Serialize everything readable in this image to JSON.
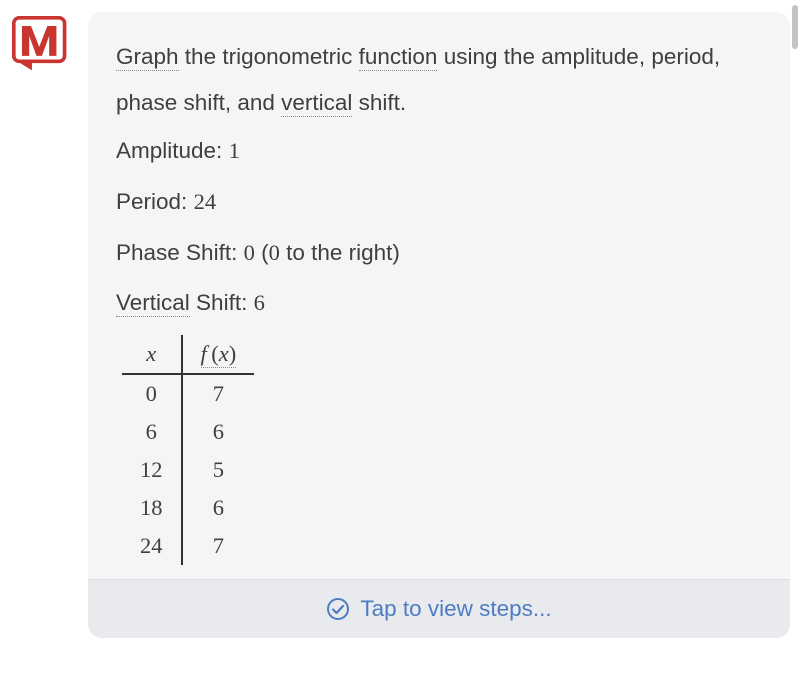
{
  "description": {
    "segments": [
      {
        "text": "Graph",
        "underline": true
      },
      {
        "text": " the trigonometric ",
        "underline": false
      },
      {
        "text": "function",
        "underline": true
      },
      {
        "text": " using the amplitude, period, phase shift, and ",
        "underline": false
      },
      {
        "text": "vertical",
        "underline": true
      },
      {
        "text": " shift.",
        "underline": false
      }
    ]
  },
  "properties": {
    "amplitude": {
      "label": "Amplitude:",
      "value": "1"
    },
    "period": {
      "label": "Period:",
      "value": "24"
    },
    "phase_shift": {
      "label": "Phase Shift:",
      "value": "0",
      "note_prefix": "(",
      "note_val": "0",
      "note_suffix": " to the right)"
    },
    "vertical_shift": {
      "label_underlined": "Vertical",
      "label_rest": " Shift:",
      "value": "6"
    }
  },
  "table": {
    "header_x": "x",
    "header_fx_f": "f",
    "header_fx_open": "(",
    "header_fx_x": "x",
    "header_fx_close": ")",
    "rows": [
      {
        "x": "0",
        "fx": "7"
      },
      {
        "x": "6",
        "fx": "6"
      },
      {
        "x": "12",
        "fx": "5"
      },
      {
        "x": "18",
        "fx": "6"
      },
      {
        "x": "24",
        "fx": "7"
      }
    ]
  },
  "tap_bar": {
    "label": "Tap to view steps..."
  }
}
